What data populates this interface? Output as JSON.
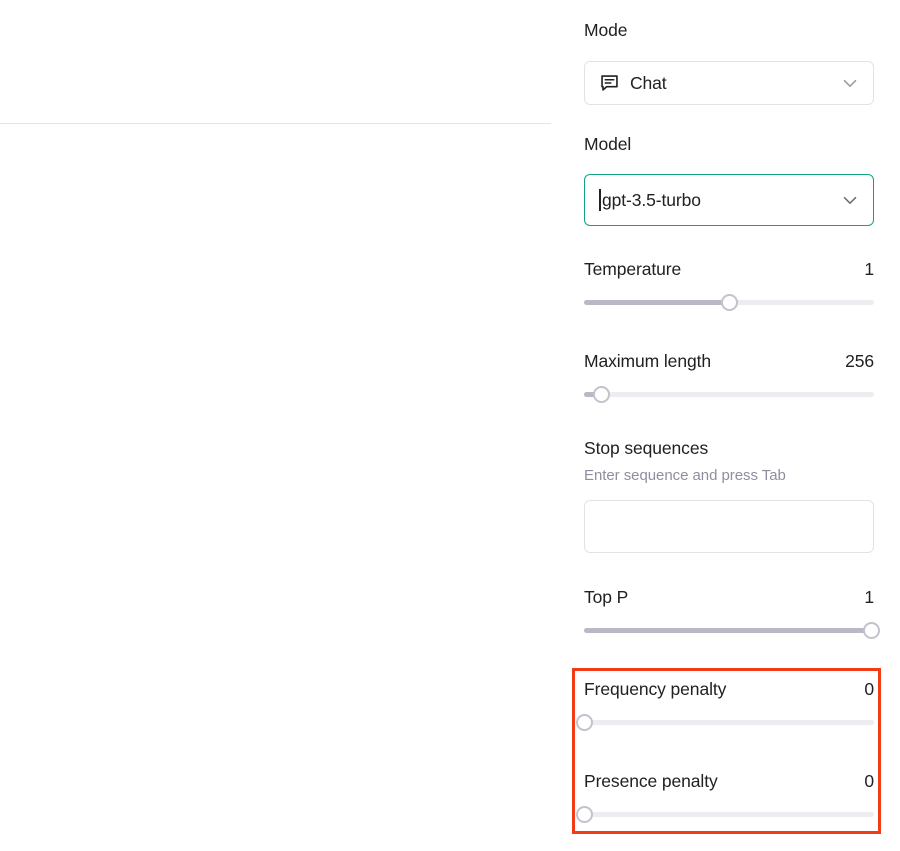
{
  "panel": {
    "mode": {
      "label": "Mode",
      "value": "Chat",
      "icon": "chat-bubble-icon",
      "chevron": "chevron-down-icon"
    },
    "model": {
      "label": "Model",
      "value": "gpt-3.5-turbo",
      "chevron": "chevron-down-icon",
      "focused": true,
      "focus_color": "#10a37f"
    },
    "temperature": {
      "label": "Temperature",
      "value": "1",
      "fill_percent": 50
    },
    "maximum_length": {
      "label": "Maximum length",
      "value": "256",
      "fill_percent": 6
    },
    "stop_sequences": {
      "label": "Stop sequences",
      "hint": "Enter sequence and press Tab",
      "value": "",
      "placeholder": ""
    },
    "top_p": {
      "label": "Top P",
      "value": "1",
      "fill_percent": 99
    },
    "frequency_penalty": {
      "label": "Frequency penalty",
      "value": "0",
      "fill_percent": 0
    },
    "presence_penalty": {
      "label": "Presence penalty",
      "value": "0",
      "fill_percent": 0
    }
  },
  "annotation": {
    "highlight_color": "#f03c17",
    "targets": "frequency-and-presence-penalty"
  },
  "theme": {
    "text": "#202123",
    "muted": "#8e8ea0",
    "border": "#e3e3e3",
    "track": "#ececf1",
    "track_fill": "#b9b9c6",
    "accent": "#10a37f"
  }
}
